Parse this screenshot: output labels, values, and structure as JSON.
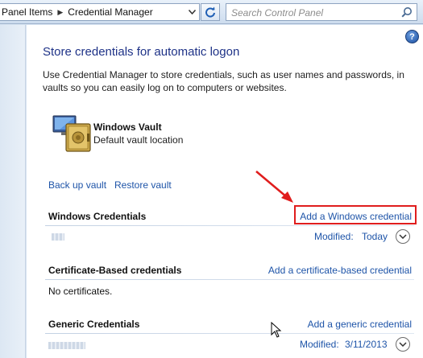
{
  "addressbar": {
    "breadcrumbs": [
      "Panel Items",
      "Credential Manager"
    ],
    "search_placeholder": "Search Control Panel"
  },
  "header": {
    "title": "Store credentials for automatic logon",
    "description": "Use Credential Manager to store credentials, such as user names and passwords, in vaults so you can easily log on to computers or websites."
  },
  "vault": {
    "name": "Windows Vault",
    "description": "Default vault location",
    "backup_label": "Back up vault",
    "restore_label": "Restore vault"
  },
  "sections": {
    "windows": {
      "title": "Windows Credentials",
      "action": "Add a Windows credential",
      "modified_label": "Modified:",
      "modified_value": "Today"
    },
    "certificate": {
      "title": "Certificate-Based credentials",
      "action": "Add a certificate-based credential",
      "empty_text": "No certificates."
    },
    "generic": {
      "title": "Generic Credentials",
      "action": "Add a generic credential",
      "modified_label": "Modified:",
      "modified_value": "3/11/2013"
    }
  },
  "colors": {
    "link": "#1e54a8",
    "title": "#1e3287",
    "highlight": "#e01d1d"
  },
  "icons": [
    "chevron-down-icon",
    "refresh-icon",
    "search-icon",
    "help-icon",
    "vault-icon",
    "expand-icon",
    "annotation-arrow",
    "mouse-cursor"
  ]
}
